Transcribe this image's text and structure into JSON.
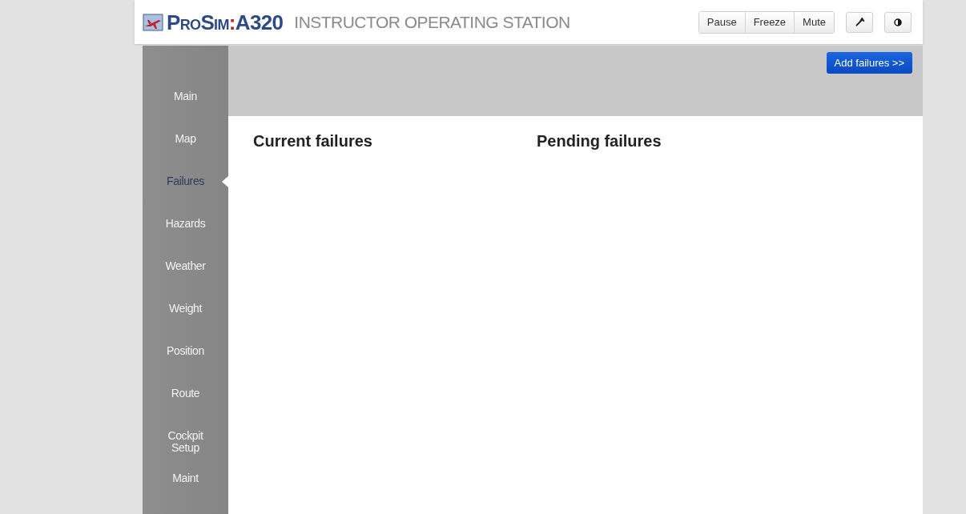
{
  "logo": {
    "name": "ProSim",
    "separator": ":",
    "model": "A320"
  },
  "header": {
    "title": "INSTRUCTOR OPERATING STATION"
  },
  "toolbar": {
    "buttons": [
      "Pause",
      "Freeze",
      "Mute"
    ]
  },
  "sidebar": {
    "items": [
      {
        "label": "Main",
        "selected": false
      },
      {
        "label": "Map",
        "selected": false
      },
      {
        "label": "Failures",
        "selected": true
      },
      {
        "label": "Hazards",
        "selected": false
      },
      {
        "label": "Weather",
        "selected": false
      },
      {
        "label": "Weight",
        "selected": false
      },
      {
        "label": "Position",
        "selected": false
      },
      {
        "label": "Route",
        "selected": false
      },
      {
        "label": "Cockpit Setup",
        "selected": false
      },
      {
        "label": "Maint",
        "selected": false
      }
    ]
  },
  "action": {
    "label": "Add failures >>"
  },
  "sections": [
    "Current failures",
    "Pending failures"
  ]
}
